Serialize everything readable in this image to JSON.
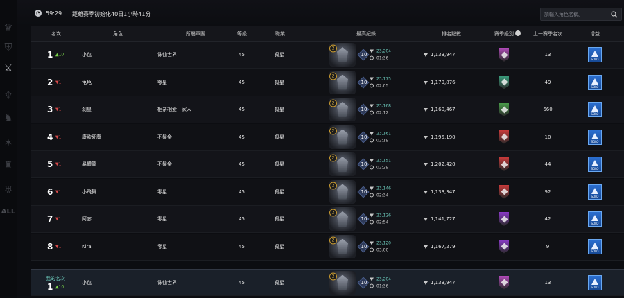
{
  "sidebar": {
    "icons": [
      "crown-icon",
      "shield-icon",
      "crossed-swords-icon",
      "wings-icon",
      "helmet-icon",
      "star-icon",
      "monster-icon",
      "horns-icon"
    ],
    "all_label": "ALL"
  },
  "header": {
    "timer": "59:29",
    "season_reset": "距離賽季初始化40日1小時41分",
    "search_placeholder": "請輸入角色名稱。"
  },
  "columns": {
    "rank": "名次",
    "character": "角色",
    "guild": "所屬軍團",
    "level": "等級",
    "class": "職業",
    "best_record": "最高紀錄",
    "points": "排名點數",
    "season_tier": "賽季級別",
    "prev_rank": "上一賽季名次",
    "buff": "增益"
  },
  "rows": [
    {
      "rank": "1",
      "change": "▲10",
      "dir": "up",
      "name": "小包",
      "guild": "诛仙世界",
      "level": "45",
      "class": "殺星",
      "badge": "2",
      "gem": "10",
      "score": "23,204",
      "time": "01:36",
      "points": "1,133,947",
      "tier_color": "#b04ab8",
      "prev": "13",
      "buff": "SOLO"
    },
    {
      "rank": "2",
      "change": "▼1",
      "dir": "down",
      "name": "龟龟",
      "guild": "零星",
      "level": "45",
      "class": "殺星",
      "badge": "2",
      "gem": "10",
      "score": "23,175",
      "time": "02:05",
      "points": "1,179,876",
      "tier_color": "#3aa07e",
      "prev": "49",
      "buff": "SOLO"
    },
    {
      "rank": "3",
      "change": "▼1",
      "dir": "down",
      "name": "刹星",
      "guild": "相亲相爱一家人",
      "level": "45",
      "class": "殺星",
      "badge": "2",
      "gem": "10",
      "score": "23,168",
      "time": "02:12",
      "points": "1,160,467",
      "tier_color": "#4aa04a",
      "prev": "660",
      "buff": "SOLO"
    },
    {
      "rank": "4",
      "change": "▼1",
      "dir": "down",
      "name": "康欲死康",
      "guild": "不鬣金",
      "level": "45",
      "class": "殺星",
      "badge": "2",
      "gem": "10",
      "score": "23,161",
      "time": "02:19",
      "points": "1,195,190",
      "tier_color": "#c83a3a",
      "prev": "10",
      "buff": "SOLO"
    },
    {
      "rank": "5",
      "change": "▼1",
      "dir": "down",
      "name": "暴體龍",
      "guild": "不鬣金",
      "level": "45",
      "class": "殺星",
      "badge": "2",
      "gem": "10",
      "score": "23,151",
      "time": "02:29",
      "points": "1,202,420",
      "tier_color": "#c83a3a",
      "prev": "44",
      "buff": "SOLO"
    },
    {
      "rank": "6",
      "change": "▼1",
      "dir": "down",
      "name": "小飛舞",
      "guild": "零星",
      "level": "45",
      "class": "殺星",
      "badge": "2",
      "gem": "10",
      "score": "23,146",
      "time": "02:34",
      "points": "1,133,347",
      "tier_color": "#c83a3a",
      "prev": "92",
      "buff": "SOLO"
    },
    {
      "rank": "7",
      "change": "▼1",
      "dir": "down",
      "name": "阿宓",
      "guild": "零星",
      "level": "45",
      "class": "殺星",
      "badge": "2",
      "gem": "10",
      "score": "23,126",
      "time": "02:54",
      "points": "1,141,727",
      "tier_color": "#8a3ac8",
      "prev": "42",
      "buff": "SOLO"
    },
    {
      "rank": "8",
      "change": "▼1",
      "dir": "down",
      "name": "Kira",
      "guild": "零星",
      "level": "45",
      "class": "殺星",
      "badge": "2",
      "gem": "10",
      "score": "23,120",
      "time": "03:00",
      "points": "1,167,279",
      "tier_color": "#8a3ac8",
      "prev": "9",
      "buff": "SOLO"
    }
  ],
  "my_rank": {
    "label": "我的名次",
    "rank": "1",
    "change": "▲10",
    "dir": "up",
    "name": "小包",
    "guild": "诛仙世界",
    "level": "45",
    "class": "殺星",
    "badge": "2",
    "gem": "10",
    "score": "23,204",
    "time": "01:36",
    "points": "1,133,947",
    "tier_color": "#b04ab8",
    "prev": "13",
    "buff": "SOLO"
  }
}
